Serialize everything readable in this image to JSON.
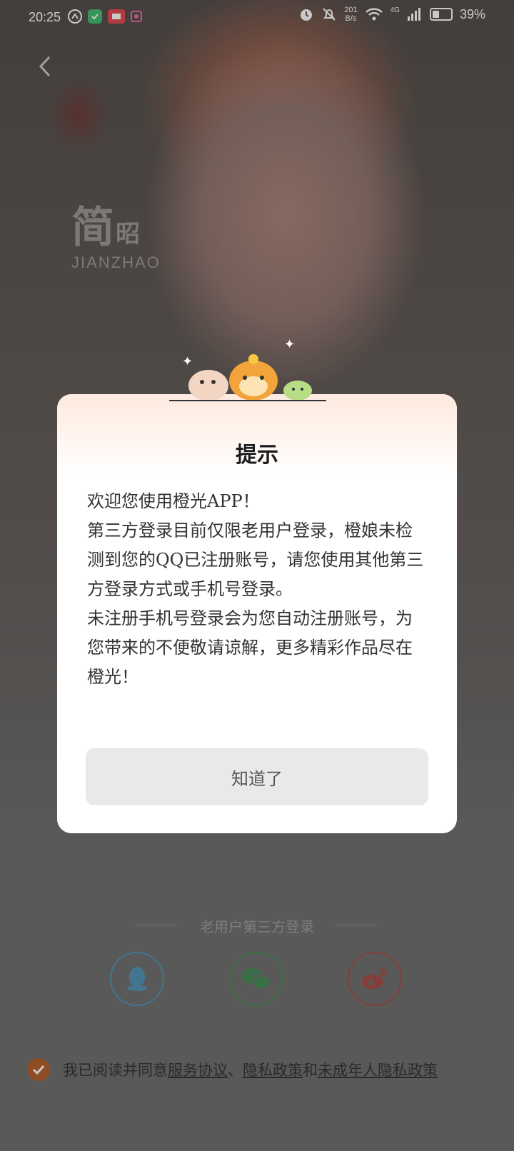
{
  "status_bar": {
    "time": "20:25",
    "net_speed_top": "201",
    "net_speed_bottom": "B/s",
    "network": "4G",
    "battery_percent": "39%",
    "battery_level": 0.39
  },
  "background": {
    "logo_main": "简",
    "logo_small": "昭",
    "logo_sub": "JIANZHAO"
  },
  "dialog": {
    "title": "提示",
    "paragraphs": [
      "欢迎您使用橙光APP！",
      "第三方登录目前仅限老用户登录，橙娘未检测到您的QQ已注册账号，请您使用其他第三方登录方式或手机号登录。",
      "未注册手机号登录会为您自动注册账号，为您带来的不便敬请谅解，更多精彩作品尽在橙光！"
    ],
    "ok_label": "知道了"
  },
  "login": {
    "third_party_title": "老用户第三方登录",
    "agree_prefix": "我已阅读并同意",
    "service_link": "服务协议",
    "separator": "、",
    "privacy_link": "隐私政策",
    "and_text": "和",
    "minor_privacy_link": "未成年人隐私政策"
  },
  "colors": {
    "accent": "#b05a22",
    "qq": "#4b8fb3",
    "wechat": "#3e8a4f",
    "weibo": "#a4463f"
  }
}
